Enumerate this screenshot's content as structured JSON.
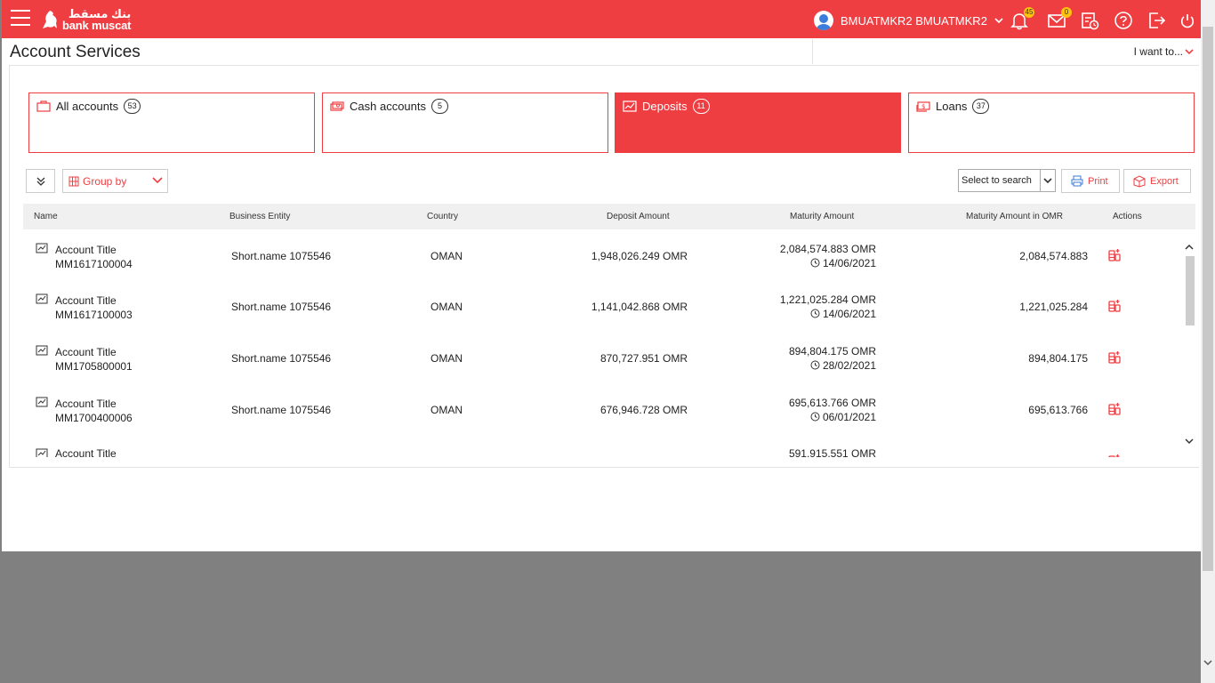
{
  "header": {
    "brand_ar": "بنك مسقط",
    "brand_en": "bank muscat",
    "user_name": "BMUATMKR2 BMUATMKR2",
    "notifications_count": "45",
    "messages_count": "0",
    "brand_color": "#ef3e42"
  },
  "page": {
    "title": "Account Services",
    "i_want_to": "I want to..."
  },
  "tabs": [
    {
      "label": "All accounts",
      "count": "53",
      "icon": "wallet-icon",
      "active": false
    },
    {
      "label": "Cash accounts",
      "count": "5",
      "icon": "cash-icon",
      "active": false
    },
    {
      "label": "Deposits",
      "count": "11",
      "icon": "chart-trend-icon",
      "active": true
    },
    {
      "label": "Loans",
      "count": "37",
      "icon": "loan-icon",
      "active": false
    }
  ],
  "toolbar": {
    "group_by": "Group by",
    "search_placeholder": "Select to search",
    "print": "Print",
    "export": "Export"
  },
  "table": {
    "columns": [
      "Name",
      "Business Entity",
      "Country",
      "Deposit Amount",
      "Maturity Amount",
      "Maturity Amount in OMR",
      "Actions"
    ],
    "rows": [
      {
        "title": "Account Title",
        "number": "MM1617100004",
        "entity": "Short.name 1075546",
        "country": "OMAN",
        "deposit": "1,948,026.249 OMR",
        "maturity": "2,084,574.883 OMR",
        "maturity_date": "14/06/2021",
        "maturity_omr": "2,084,574.883"
      },
      {
        "title": "Account Title",
        "number": "MM1617100003",
        "entity": "Short.name 1075546",
        "country": "OMAN",
        "deposit": "1,141,042.868 OMR",
        "maturity": "1,221,025.284 OMR",
        "maturity_date": "14/06/2021",
        "maturity_omr": "1,221,025.284"
      },
      {
        "title": "Account Title",
        "number": "MM1705800001",
        "entity": "Short.name 1075546",
        "country": "OMAN",
        "deposit": "870,727.951 OMR",
        "maturity": "894,804.175 OMR",
        "maturity_date": "28/02/2021",
        "maturity_omr": "894,804.175"
      },
      {
        "title": "Account Title",
        "number": "MM1700400006",
        "entity": "Short.name 1075546",
        "country": "OMAN",
        "deposit": "676,946.728 OMR",
        "maturity": "695,613.766 OMR",
        "maturity_date": "06/01/2021",
        "maturity_omr": "695,613.766"
      },
      {
        "title": "Account Title",
        "number": "",
        "entity": "",
        "country": "",
        "deposit": "",
        "maturity": "591,915.551 OMR",
        "maturity_date": "",
        "maturity_omr": ""
      }
    ]
  }
}
